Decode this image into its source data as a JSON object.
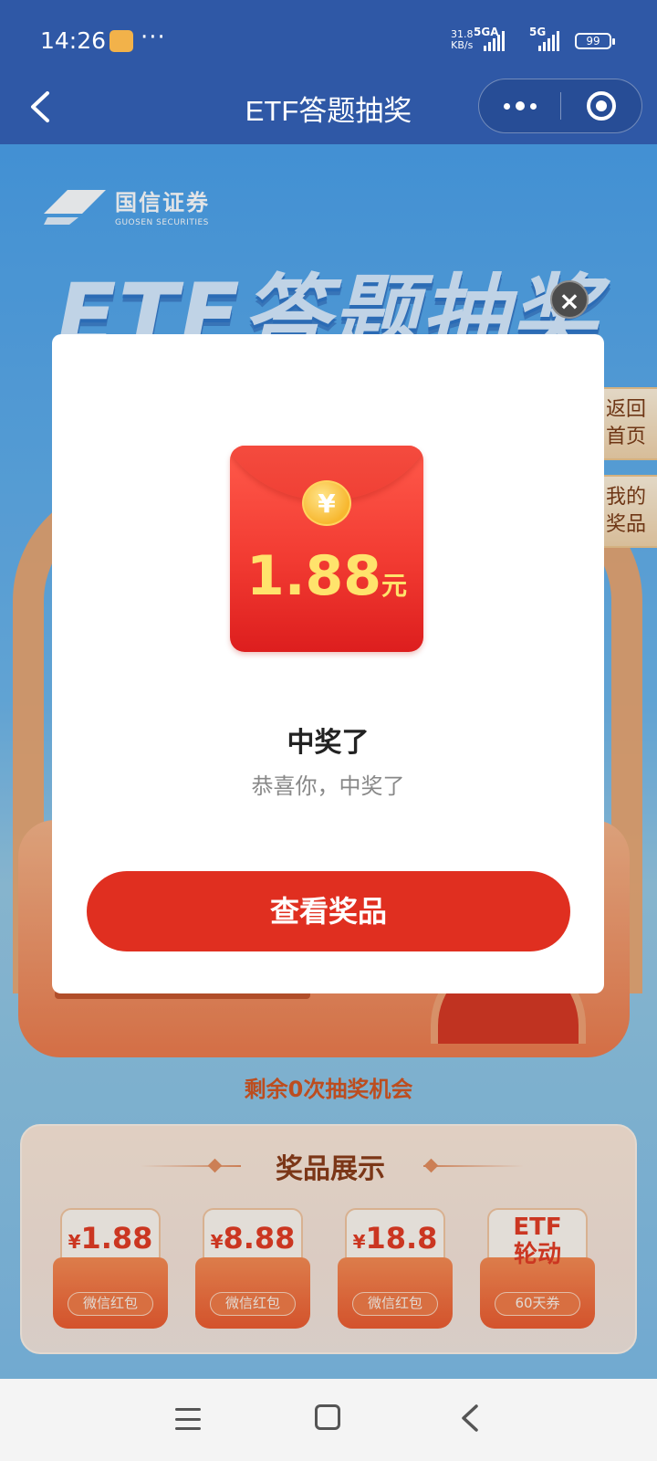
{
  "status_bar": {
    "time": "14:26",
    "dots": "···",
    "net_speed": "31.8",
    "net_unit": "KB/s",
    "sim1": "5GA",
    "sim2": "5G",
    "battery": "99"
  },
  "navbar": {
    "title": "ETF答题抽奖",
    "more_icon": "more-dots-icon",
    "close_icon": "target-circle-icon"
  },
  "page": {
    "logo_cn": "国信证券",
    "logo_en": "GUOSEN SECURITIES",
    "hero_title": "ETF答题抽奖",
    "side_tabs": [
      {
        "label": "返回首页"
      },
      {
        "label": "我的奖品"
      }
    ],
    "chances_text": "剩余0次抽奖机会",
    "prize_section": {
      "title": "奖品展示",
      "items": [
        {
          "currency": "¥",
          "value": "1.88",
          "sub": "微信红包"
        },
        {
          "currency": "¥",
          "value": "8.88",
          "sub": "微信红包"
        },
        {
          "currency": "¥",
          "value": "18.8",
          "sub": "微信红包"
        },
        {
          "line1": "ETF",
          "line2": "轮动",
          "sub": "60天券"
        }
      ]
    }
  },
  "modal": {
    "close_label": "×",
    "coin_symbol": "¥",
    "amount": "1.88",
    "unit": "元",
    "title": "中奖了",
    "subtitle": "恭喜你，中奖了",
    "button": "查看奖品"
  },
  "colors": {
    "nav_bg": "#2f58a6",
    "accent_red": "#e02f20",
    "prize_text": "#e53a1f"
  }
}
